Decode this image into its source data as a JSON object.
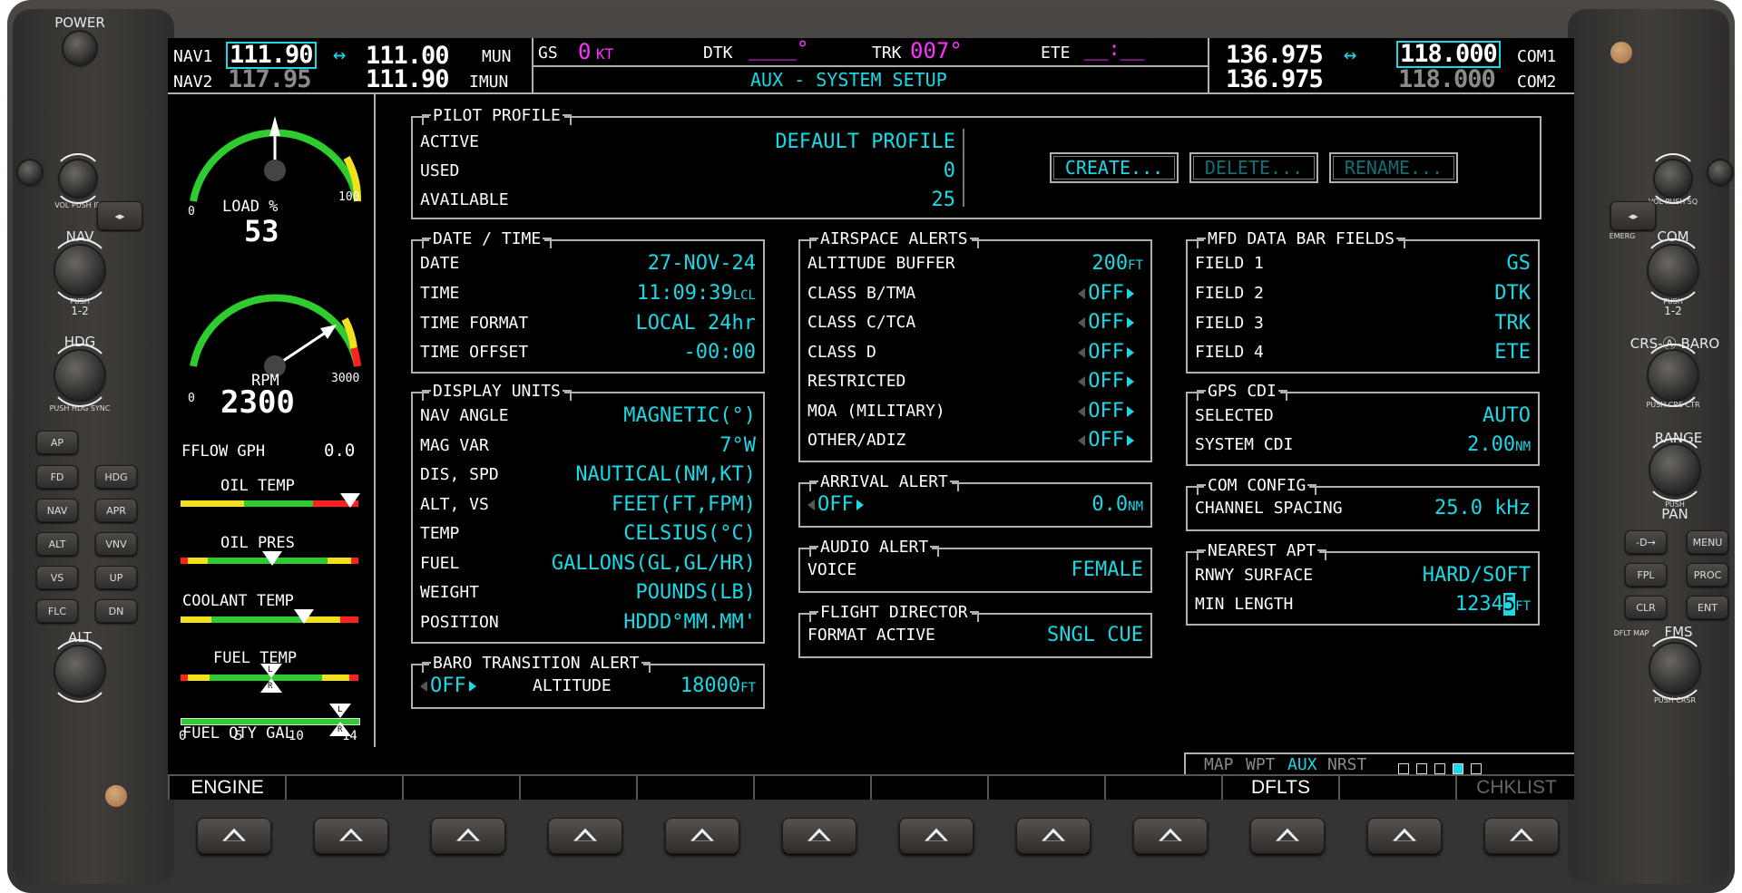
{
  "bezel": {
    "left": {
      "power": "POWER",
      "nav": "NAV",
      "nav_push": "PUSH",
      "nav_12": "1-2",
      "vol_id": "VOL PUSH ID",
      "hdg": "HDG",
      "hdg_push": "PUSH HDG SYNC",
      "alt": "ALT",
      "buttons": [
        "AP",
        "FD",
        "HDG",
        "NAV",
        "APR",
        "ALT",
        "VNV",
        "VS",
        "UP",
        "FLC",
        "DN"
      ]
    },
    "right": {
      "com": "COM",
      "com_push": "PUSH",
      "com_12": "1-2",
      "vol_sq": "VOL PUSH SQ",
      "emerg": "EMERG",
      "crs_baro": "CRS-Ⓐ-BARO",
      "crs_push": "PUSH CRS CTR",
      "range": "RANGE",
      "pan_push": "PUSH",
      "pan": "PAN",
      "fms": "FMS",
      "fms_push": "PUSH CRSR",
      "dflt_map": "DFLT MAP",
      "buttons": [
        "-D→",
        "MENU",
        "FPL",
        "PROC",
        "CLR",
        "ENT"
      ]
    }
  },
  "topbar": {
    "nav1_label": "NAV1",
    "nav1_active": "111.90",
    "nav1_standby": "111.00",
    "nav1_id": "MUN",
    "nav2_label": "NAV2",
    "nav2_active": "117.95",
    "nav2_standby": "111.90",
    "nav2_id": "IMUN",
    "gs_label": "GS",
    "gs_value": "0",
    "gs_unit": "KT",
    "dtk_label": "DTK",
    "dtk_value": "____°",
    "trk_label": "TRK",
    "trk_value": "007°",
    "ete_label": "ETE",
    "ete_value": "__:__",
    "page_title": "AUX - SYSTEM SETUP",
    "com1_active": "136.975",
    "com1_standby": "118.000",
    "com1_label": "COM1",
    "com2_active": "136.975",
    "com2_standby": "118.000",
    "com2_label": "COM2"
  },
  "eis": {
    "load_label": "LOAD %",
    "load_value": "53",
    "load_min": "0",
    "load_max": "100",
    "load_level": 0.53,
    "rpm_label": "RPM",
    "rpm_value": "2300",
    "rpm_min": "0",
    "rpm_max": "3000",
    "rpm_level": 0.767,
    "fflow_label": "FFLOW GPH",
    "fflow_value": "0.0",
    "oil_temp": "OIL TEMP",
    "oil_pres": "OIL PRES",
    "coolant_temp": "COOLANT TEMP",
    "fuel_temp": "FUEL TEMP",
    "fuel_qty": "FUEL QTY GAL",
    "fuel_ticks": [
      "0",
      "5",
      "10",
      "14"
    ],
    "tank_left": "L",
    "tank_right": "R"
  },
  "pilot_profile": {
    "title": "PILOT PROFILE",
    "active_label": "ACTIVE",
    "active_value": "DEFAULT PROFILE",
    "used_label": "USED",
    "used_value": "0",
    "available_label": "AVAILABLE",
    "available_value": "25",
    "create": "CREATE...",
    "delete": "DELETE...",
    "rename": "RENAME..."
  },
  "date_time": {
    "title": "DATE / TIME",
    "date_label": "DATE",
    "date_value": "27-NOV-24",
    "time_label": "TIME",
    "time_value": "11:09:39",
    "time_unit": "LCL",
    "format_label": "TIME FORMAT",
    "format_value": "LOCAL 24hr",
    "offset_label": "TIME OFFSET",
    "offset_value": "-00:00"
  },
  "display_units": {
    "title": "DISPLAY UNITS",
    "rows": [
      {
        "k": "NAV ANGLE",
        "v": "MAGNETIC(°)"
      },
      {
        "k": "MAG VAR",
        "v": "7°W"
      },
      {
        "k": "DIS, SPD",
        "v": "NAUTICAL(NM,KT)"
      },
      {
        "k": "ALT, VS",
        "v": "FEET(FT,FPM)"
      },
      {
        "k": "TEMP",
        "v": "CELSIUS(°C)"
      },
      {
        "k": "FUEL",
        "v": "GALLONS(GL,GL/HR)"
      },
      {
        "k": "WEIGHT",
        "v": "POUNDS(LB)"
      },
      {
        "k": "POSITION",
        "v": "HDDD°MM.MM'"
      }
    ]
  },
  "baro_alert": {
    "title": "BARO TRANSITION ALERT",
    "state": "OFF",
    "altitude_label": "ALTITUDE",
    "altitude_value": "18000",
    "altitude_unit": "FT"
  },
  "airspace_alerts": {
    "title": "AIRSPACE ALERTS",
    "buffer_label": "ALTITUDE BUFFER",
    "buffer_value": "200",
    "buffer_unit": "FT",
    "rows": [
      {
        "k": "CLASS B/TMA",
        "v": "OFF"
      },
      {
        "k": "CLASS C/TCA",
        "v": "OFF"
      },
      {
        "k": "CLASS D",
        "v": "OFF"
      },
      {
        "k": "RESTRICTED",
        "v": "OFF"
      },
      {
        "k": "MOA (MILITARY)",
        "v": "OFF"
      },
      {
        "k": "OTHER/ADIZ",
        "v": "OFF"
      }
    ]
  },
  "arrival_alert": {
    "title": "ARRIVAL ALERT",
    "state": "OFF",
    "value": "0.0",
    "unit": "NM"
  },
  "audio_alert": {
    "title": "AUDIO ALERT",
    "voice_label": "VOICE",
    "voice_value": "FEMALE"
  },
  "flight_director": {
    "title": "FLIGHT DIRECTOR",
    "format_label": "FORMAT ACTIVE",
    "format_value": "SNGL CUE"
  },
  "mfd_fields": {
    "title": "MFD DATA BAR FIELDS",
    "rows": [
      {
        "k": "FIELD 1",
        "v": "GS"
      },
      {
        "k": "FIELD 2",
        "v": "DTK"
      },
      {
        "k": "FIELD 3",
        "v": "TRK"
      },
      {
        "k": "FIELD 4",
        "v": "ETE"
      }
    ]
  },
  "gps_cdi": {
    "title": "GPS CDI",
    "selected_label": "SELECTED",
    "selected_value": "AUTO",
    "system_label": "SYSTEM CDI",
    "system_value": "2.00",
    "system_unit": "NM"
  },
  "com_config": {
    "title": "COM CONFIG",
    "spacing_label": "CHANNEL SPACING",
    "spacing_value": "25.0 kHz"
  },
  "nearest_apt": {
    "title": "NEAREST APT",
    "surface_label": "RNWY SURFACE",
    "surface_value": "HARD/SOFT",
    "length_label": "MIN LENGTH",
    "length_prefix": "1234",
    "length_cursor": "5",
    "length_unit": "FT"
  },
  "page_group": {
    "map": "MAP",
    "wpt": "WPT",
    "aux": "AUX",
    "nrst": "NRST",
    "page_count": 5,
    "current_page": 4
  },
  "softkeys": {
    "labels": [
      "ENGINE",
      "",
      "",
      "",
      "",
      "",
      "",
      "",
      "",
      "DFLTS",
      "",
      "CHKLIST"
    ]
  }
}
